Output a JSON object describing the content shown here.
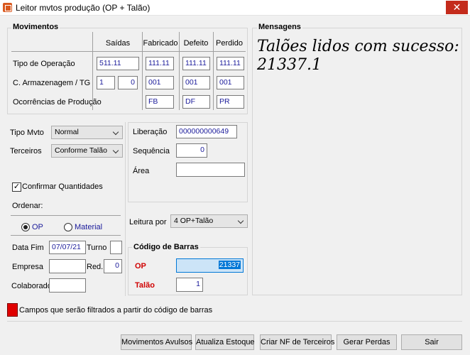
{
  "window": {
    "title": "Leitor mvtos produção (OP + Talão)",
    "close_symbol": "✕"
  },
  "movimentos": {
    "title": "Movimentos",
    "columns": [
      "Saídas",
      "Fabricado",
      "Defeito",
      "Perdido"
    ],
    "rows": {
      "tipo_operacao": {
        "label": "Tipo de Operação",
        "saidas": "511.11",
        "fabricado": "111.11",
        "defeito": "111.11",
        "perdido": "111.11"
      },
      "armazenagem": {
        "label": "C. Armazenagem / TG",
        "saidas_a": "1",
        "saidas_b": "0",
        "fabricado": "001",
        "defeito": "001",
        "perdido": "001"
      },
      "ocorrencias": {
        "label": "Ocorrências de Produção",
        "fabricado": "FB",
        "defeito": "DF",
        "perdido": "PR"
      }
    }
  },
  "form": {
    "tipo_mvto_label": "Tipo Mvto",
    "tipo_mvto_value": "Normal",
    "terceiros_label": "Terceiros",
    "terceiros_value": "Conforme Talão",
    "confirmar_label": "Confirmar Quantidades",
    "confirmar_mark": "✓",
    "ordenar_label": "Ordenar:",
    "radio_op": "OP",
    "radio_material": "Material",
    "data_fim_label": "Data Fim",
    "data_fim_value": "07/07/21",
    "turno_label": "Turno",
    "turno_value": "",
    "empresa_label": "Empresa",
    "empresa_value": "",
    "red_label": "Red.",
    "red_value": "0",
    "colaborador_label": "Colaborador",
    "colaborador_value": ""
  },
  "liberacao": {
    "liberacao_label": "Liberação",
    "liberacao_value": "000000000649",
    "sequencia_label": "Sequência",
    "sequencia_value": "0",
    "area_label": "Área",
    "area_value": ""
  },
  "leitura": {
    "label": "Leitura por",
    "value": "4 OP+Talão"
  },
  "codigo": {
    "title": "Código de Barras",
    "op_label": "OP",
    "op_value": "21337",
    "talao_label": "Talão",
    "talao_value": "1"
  },
  "mensagens": {
    "title": "Mensagens",
    "line1": "Talões lidos com sucesso:",
    "line2": "21337.1"
  },
  "legend": {
    "text": "Campos que serão filtrados a partir do código de barras",
    "color": "#e00000"
  },
  "buttons": {
    "movimentos_avulsos": "Movimentos Avulsos",
    "atualiza_estoque": "Atualiza Estoque",
    "criar_nf": "Criar NF de Terceiros",
    "gerar_perdas": "Gerar Perdas",
    "sair": "Sair"
  }
}
